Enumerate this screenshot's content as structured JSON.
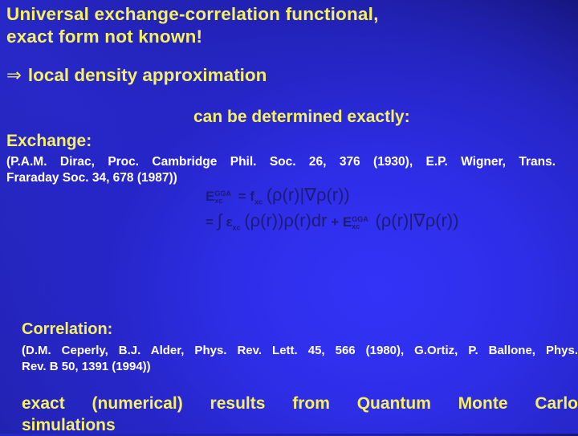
{
  "slide": {
    "title_lines": [
      "Universal exchange-correlation  functional,",
      "exact form not known!"
    ],
    "lda": {
      "arrow_icon": "implies-arrow",
      "arrow_glyph": "⇒",
      "text": "local density approximation"
    },
    "determined_text": "can be determined exactly:",
    "exchange": {
      "label": "Exchange:",
      "reference_lines": [
        "(P.A.M. Dirac, Proc. Cambridge Phil. Soc. 26, 376 (1930), E.P. Wigner, Trans.",
        "Fraraday Soc. 34, 678 (1987))"
      ]
    },
    "formula": {
      "line1": {
        "lhs": "E",
        "lhs_sup": "GGA",
        "lhs_sub": "xc",
        "eq": "=",
        "f": "f",
        "f_sub": "xc",
        "args": "(ρ(r)|∇ρ(r))"
      },
      "line2": {
        "eq": "=",
        "integral": "∫",
        "eps": "ε",
        "eps_sub": "xc",
        "term1": "(ρ(r))ρ(r)dr",
        "plus": "+",
        "E": "E",
        "E_sup": "GGA",
        "E_sub": "xc",
        "args": "(ρ(r)|∇ρ(r))"
      }
    },
    "correlation": {
      "label": "Correlation:",
      "reference_lines": [
        "(D.M. Ceperly, B.J. Alder, Phys. Rev. Lett. 45, 566 (1980), G.Ortiz, P. Ballone, Phys.",
        "Rev. B 50, 1391 (1994))"
      ]
    },
    "qmc_lines": [
      "exact (numerical) results from Quantum Monte Carlo",
      "simulations"
    ],
    "colors": {
      "heading_yellow": "#f6f064",
      "reference_white": "#ffffff",
      "formula_navy": "#1c1c78",
      "background_bright": "#3333f8",
      "background_dark": "#15157a"
    }
  }
}
